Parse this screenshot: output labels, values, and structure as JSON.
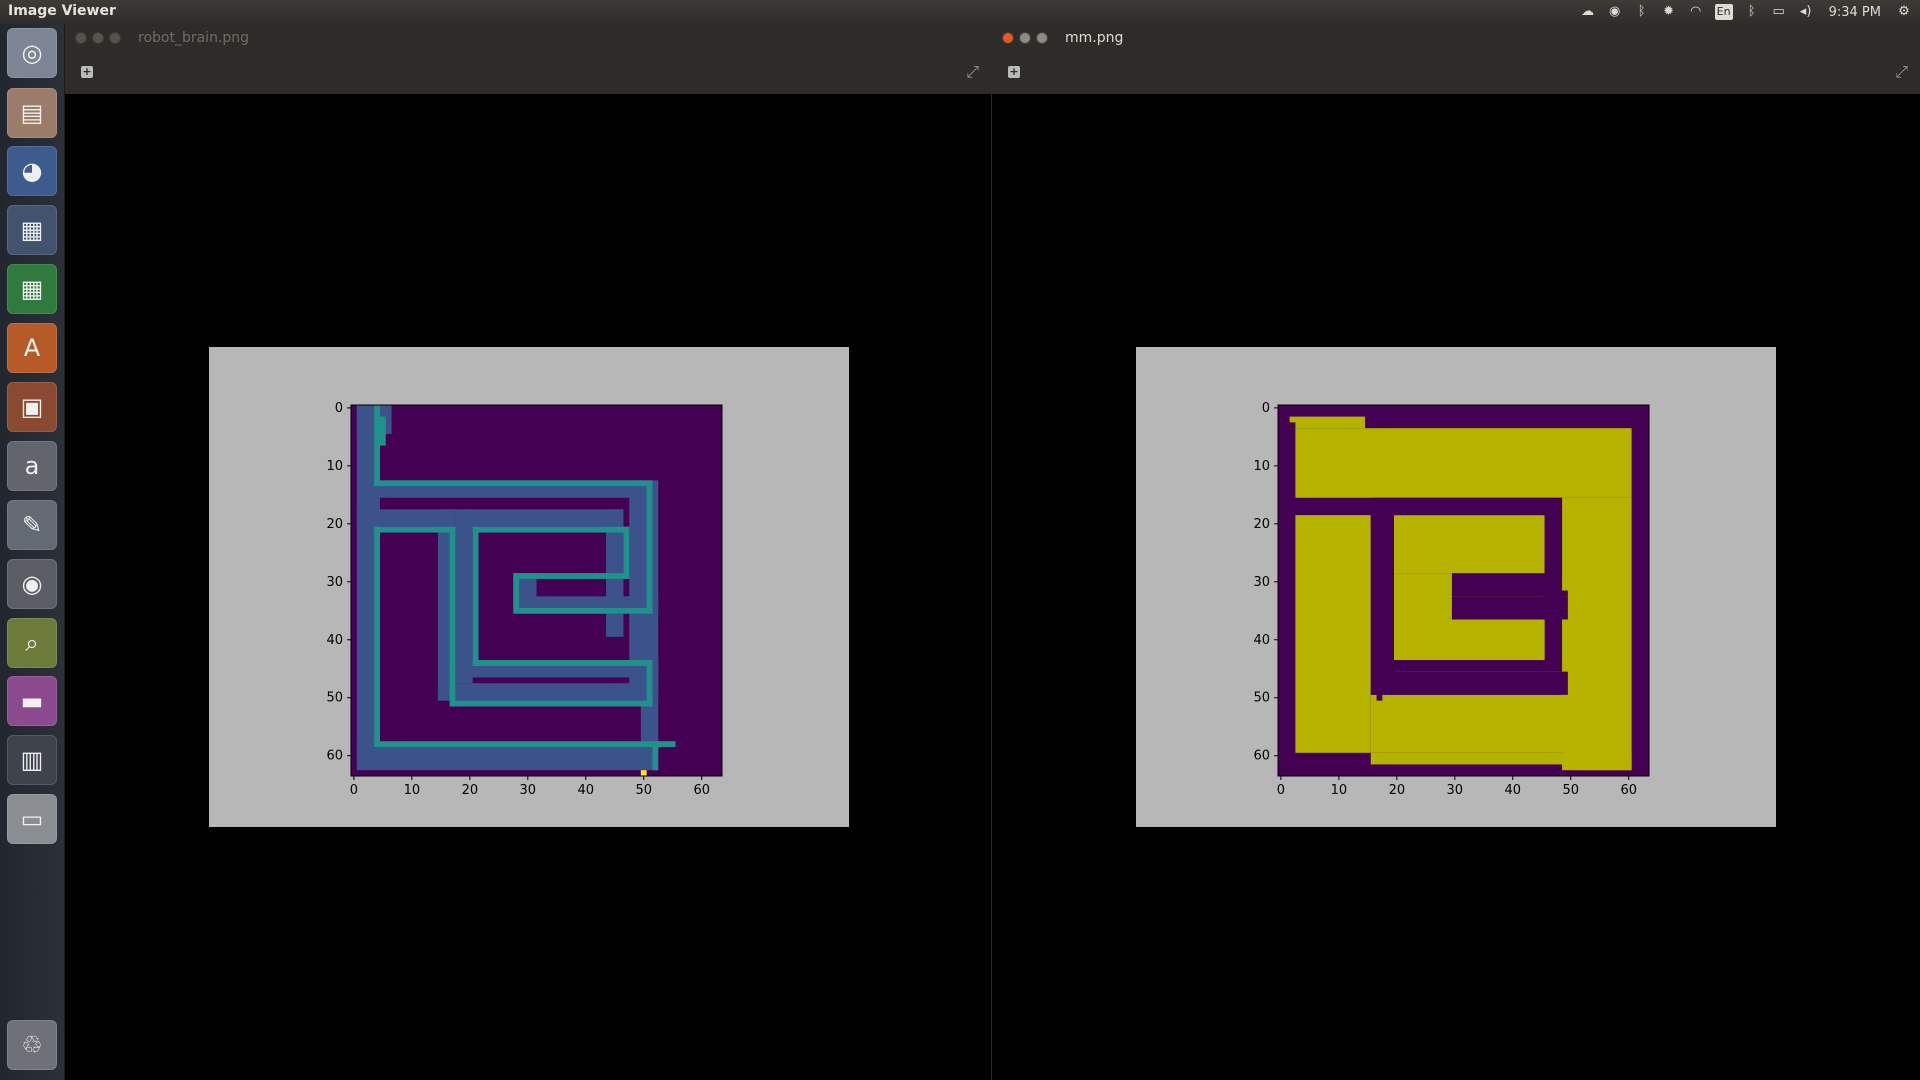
{
  "top_bar": {
    "title": "Image Viewer",
    "clock": "9:34 PM",
    "keyboard_layout": "En",
    "tray_icons": [
      "dropbox-icon",
      "chrome-icon",
      "bluetooth-icon",
      "settings-gear-icon",
      "wifi-icon",
      "keyboard-layout-icon",
      "bluetooth-icon",
      "battery-icon",
      "volume-icon",
      "system-gear-icon"
    ]
  },
  "launcher": {
    "items": [
      {
        "name": "ubuntu-dash-icon",
        "color": "#7d8594"
      },
      {
        "name": "files-icon",
        "color": "#9b7c6b"
      },
      {
        "name": "firefox-icon",
        "color": "#3d5b8c"
      },
      {
        "name": "writer-icon",
        "color": "#41536e"
      },
      {
        "name": "calc-icon",
        "color": "#2f7a3c"
      },
      {
        "name": "software-center-icon",
        "color": "#b65a2a"
      },
      {
        "name": "impress-icon",
        "color": "#8a4a31"
      },
      {
        "name": "amazon-icon",
        "color": "#62656b"
      },
      {
        "name": "system-settings-icon",
        "color": "#646a74"
      },
      {
        "name": "chrome-icon",
        "color": "#5a5e64"
      },
      {
        "name": "image-viewer-icon",
        "color": "#6c7a3a"
      },
      {
        "name": "workspace-switcher-icon",
        "color": "#8c4a8e"
      },
      {
        "name": "window-spread-icon",
        "color": "#3e434c"
      },
      {
        "name": "drive-icon",
        "color": "#8a8d92"
      },
      {
        "name": "trash-icon",
        "color": "#6e7278"
      }
    ]
  },
  "windows": [
    {
      "filename": "robot_brain.png",
      "active": false,
      "chart_data": {
        "type": "heatmap",
        "title": "",
        "xlabel": "",
        "ylabel": "",
        "grid_size": [
          64,
          64
        ],
        "xlim": [
          0,
          64
        ],
        "ylim": [
          64,
          0
        ],
        "xticks": [
          "0",
          "10",
          "20",
          "30",
          "40",
          "50",
          "60"
        ],
        "yticks": [
          "0",
          "10",
          "20",
          "30",
          "40",
          "50",
          "60"
        ],
        "colormap": "viridis",
        "background_color": "#440154",
        "thick_band_color": "#3b528b",
        "inner_line_color": "#21918c",
        "marker_color": "#fde725",
        "thick_band_cells": [
          [
            1,
            0,
            6,
            5
          ],
          [
            1,
            0,
            4,
            61
          ],
          [
            2,
            13,
            48,
            3
          ],
          [
            48,
            13,
            5,
            36
          ],
          [
            1,
            18,
            17,
            3
          ],
          [
            15,
            18,
            3,
            33
          ],
          [
            19,
            18,
            28,
            3
          ],
          [
            44,
            18,
            3,
            22
          ],
          [
            18,
            18,
            3,
            30
          ],
          [
            28,
            29,
            4,
            6
          ],
          [
            28,
            33,
            25,
            3
          ],
          [
            18,
            44,
            35,
            3
          ],
          [
            50,
            44,
            3,
            16
          ],
          [
            15,
            48,
            38,
            3
          ],
          [
            1,
            59,
            52,
            4
          ]
        ],
        "inner_line_cells": [
          [
            4,
            0,
            1,
            14
          ],
          [
            5,
            2,
            1,
            5
          ],
          [
            4,
            13,
            48,
            1
          ],
          [
            51,
            14,
            1,
            22
          ],
          [
            28,
            35,
            24,
            1
          ],
          [
            28,
            29,
            1,
            6
          ],
          [
            29,
            29,
            19,
            1
          ],
          [
            47,
            21,
            1,
            9
          ],
          [
            21,
            21,
            27,
            1
          ],
          [
            21,
            21,
            1,
            24
          ],
          [
            21,
            44,
            30,
            1
          ],
          [
            51,
            44,
            1,
            8
          ],
          [
            17,
            51,
            35,
            1
          ],
          [
            17,
            21,
            1,
            31
          ],
          [
            4,
            21,
            14,
            1
          ],
          [
            4,
            21,
            1,
            38
          ],
          [
            4,
            58,
            52,
            1
          ],
          [
            52,
            58,
            1,
            5
          ]
        ],
        "marker_cells": [
          [
            50,
            63,
            1,
            1
          ]
        ]
      }
    },
    {
      "filename": "mm.png",
      "active": true,
      "chart_data": {
        "type": "heatmap",
        "title": "",
        "xlabel": "",
        "ylabel": "",
        "grid_size": [
          64,
          64
        ],
        "xlim": [
          0,
          64
        ],
        "ylim": [
          64,
          0
        ],
        "xticks": [
          "0",
          "10",
          "20",
          "30",
          "40",
          "50",
          "60"
        ],
        "yticks": [
          "0",
          "10",
          "20",
          "30",
          "40",
          "50",
          "60"
        ],
        "colormap": "viridis",
        "background_color": "#440154",
        "fill_color": "#b5b200",
        "fill_cells": [
          [
            2,
            2,
            13,
            2
          ],
          [
            2,
            4,
            1,
            0
          ],
          [
            3,
            4,
            58,
            12
          ],
          [
            49,
            16,
            12,
            47
          ],
          [
            3,
            19,
            13,
            41
          ],
          [
            20,
            19,
            26,
            10
          ],
          [
            20,
            29,
            10,
            3
          ],
          [
            20,
            32,
            26,
            12
          ],
          [
            20,
            44,
            26,
            0
          ],
          [
            20,
            46,
            29,
            0
          ],
          [
            20,
            46,
            30,
            2
          ],
          [
            16,
            50,
            35,
            10
          ],
          [
            16,
            60,
            34,
            2
          ],
          [
            51,
            60,
            10,
            3
          ]
        ],
        "wall_cells": [
          [
            2,
            3,
            1,
            1
          ],
          [
            16,
            16,
            33,
            3
          ],
          [
            16,
            19,
            4,
            31
          ],
          [
            46,
            19,
            3,
            11
          ],
          [
            30,
            32,
            20,
            1
          ],
          [
            30,
            33,
            20,
            4
          ],
          [
            20,
            46,
            30,
            4
          ],
          [
            17,
            49,
            1,
            2
          ]
        ]
      }
    }
  ]
}
